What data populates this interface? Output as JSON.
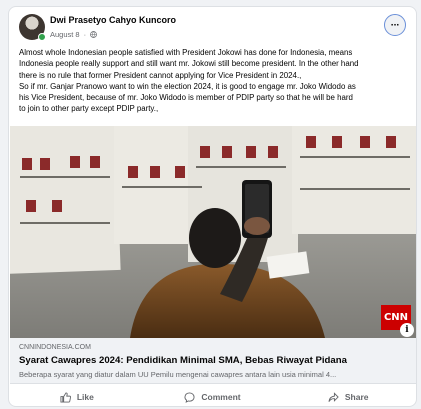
{
  "post": {
    "author": "Dwi Prasetyo Cahyo Kuncoro",
    "date": "August 8",
    "more_label": "···",
    "text_lines": [
      "Almost whole Indonesian people satisfied with President Jokowi has done for Indonesia, means",
      "Indonesia people really support and still want mr. Jokowi still become president. In the other hand",
      "there is no rule that former President cannot applying for Vice President in 2024.,",
      "So if mr. Ganjar Pranowo want to win the election 2024, it is good to engage mr. Joko Widodo as",
      "his Vice President, because of mr. Joko Widodo is member of PDIP party so that he will be hard",
      "to join to other party except PDIP party.,"
    ]
  },
  "link": {
    "domain": "CNNINDONESIA.COM",
    "title": "Syarat Cawapres 2024: Pendidikan Minimal SMA, Bebas Riwayat Pidana",
    "description": "Beberapa syarat yang diatur dalam UU Pemilu mengenai cawapres antara lain usia minimal 4...",
    "logo_text": "CNN",
    "info_label": "i"
  },
  "actions": {
    "like": "Like",
    "comment": "Comment",
    "share": "Share"
  },
  "icons": {
    "avatar": "avatar",
    "privacy": "globe-icon",
    "like": "thumbs-up-icon",
    "comment": "comment-icon",
    "share": "share-icon"
  },
  "colors": {
    "cnn_red": "#cc0000",
    "online": "#31a24c",
    "secondary_text": "#65676b"
  }
}
